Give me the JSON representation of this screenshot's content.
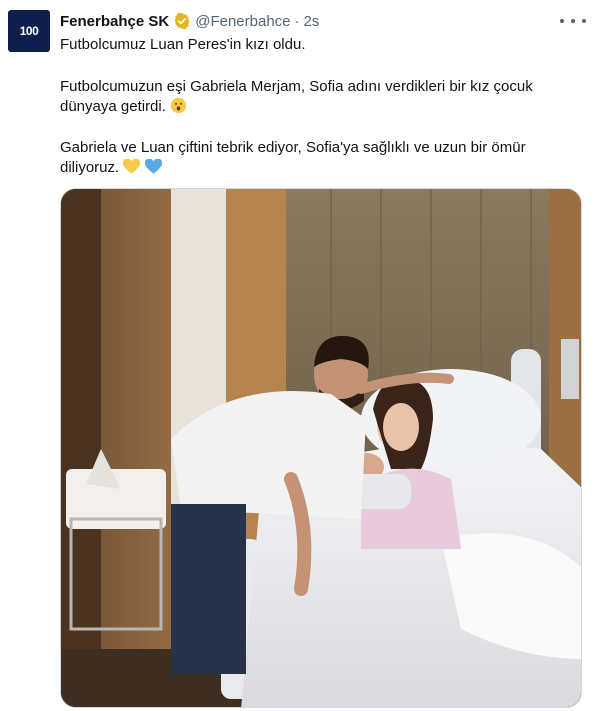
{
  "tweet": {
    "avatar_label": "100",
    "display_name": "Fenerbahçe SK",
    "verified_icon": "verified-badge-icon",
    "handle": "@Fenerbahce",
    "separator": "·",
    "time": "2s",
    "more_icon": "more-dots-icon",
    "paragraphs": [
      "Futbolcumuz Luan Peres'in kızı oldu.",
      "Futbolcumuzun eşi Gabriela Merjam, Sofia adını verdikleri bir kız çocuk dünyaya getirdi.",
      "Gabriela ve Luan çiftini tebrik ediyor, Sofia'ya sağlıklı ve uzun bir ömür diliyoruz."
    ],
    "emojis": [
      "smiling-face-icon",
      "yellow-heart-icon",
      "blue-heart-icon"
    ],
    "media_icon": "hospital-photo-image"
  },
  "colors": {
    "text": "#0f1419",
    "secondary": "#536471",
    "verified": "#e2b719",
    "yellow_heart": "#f7c948",
    "blue_heart": "#5aa9e6",
    "avatar_bg": "#0f1f4b"
  }
}
